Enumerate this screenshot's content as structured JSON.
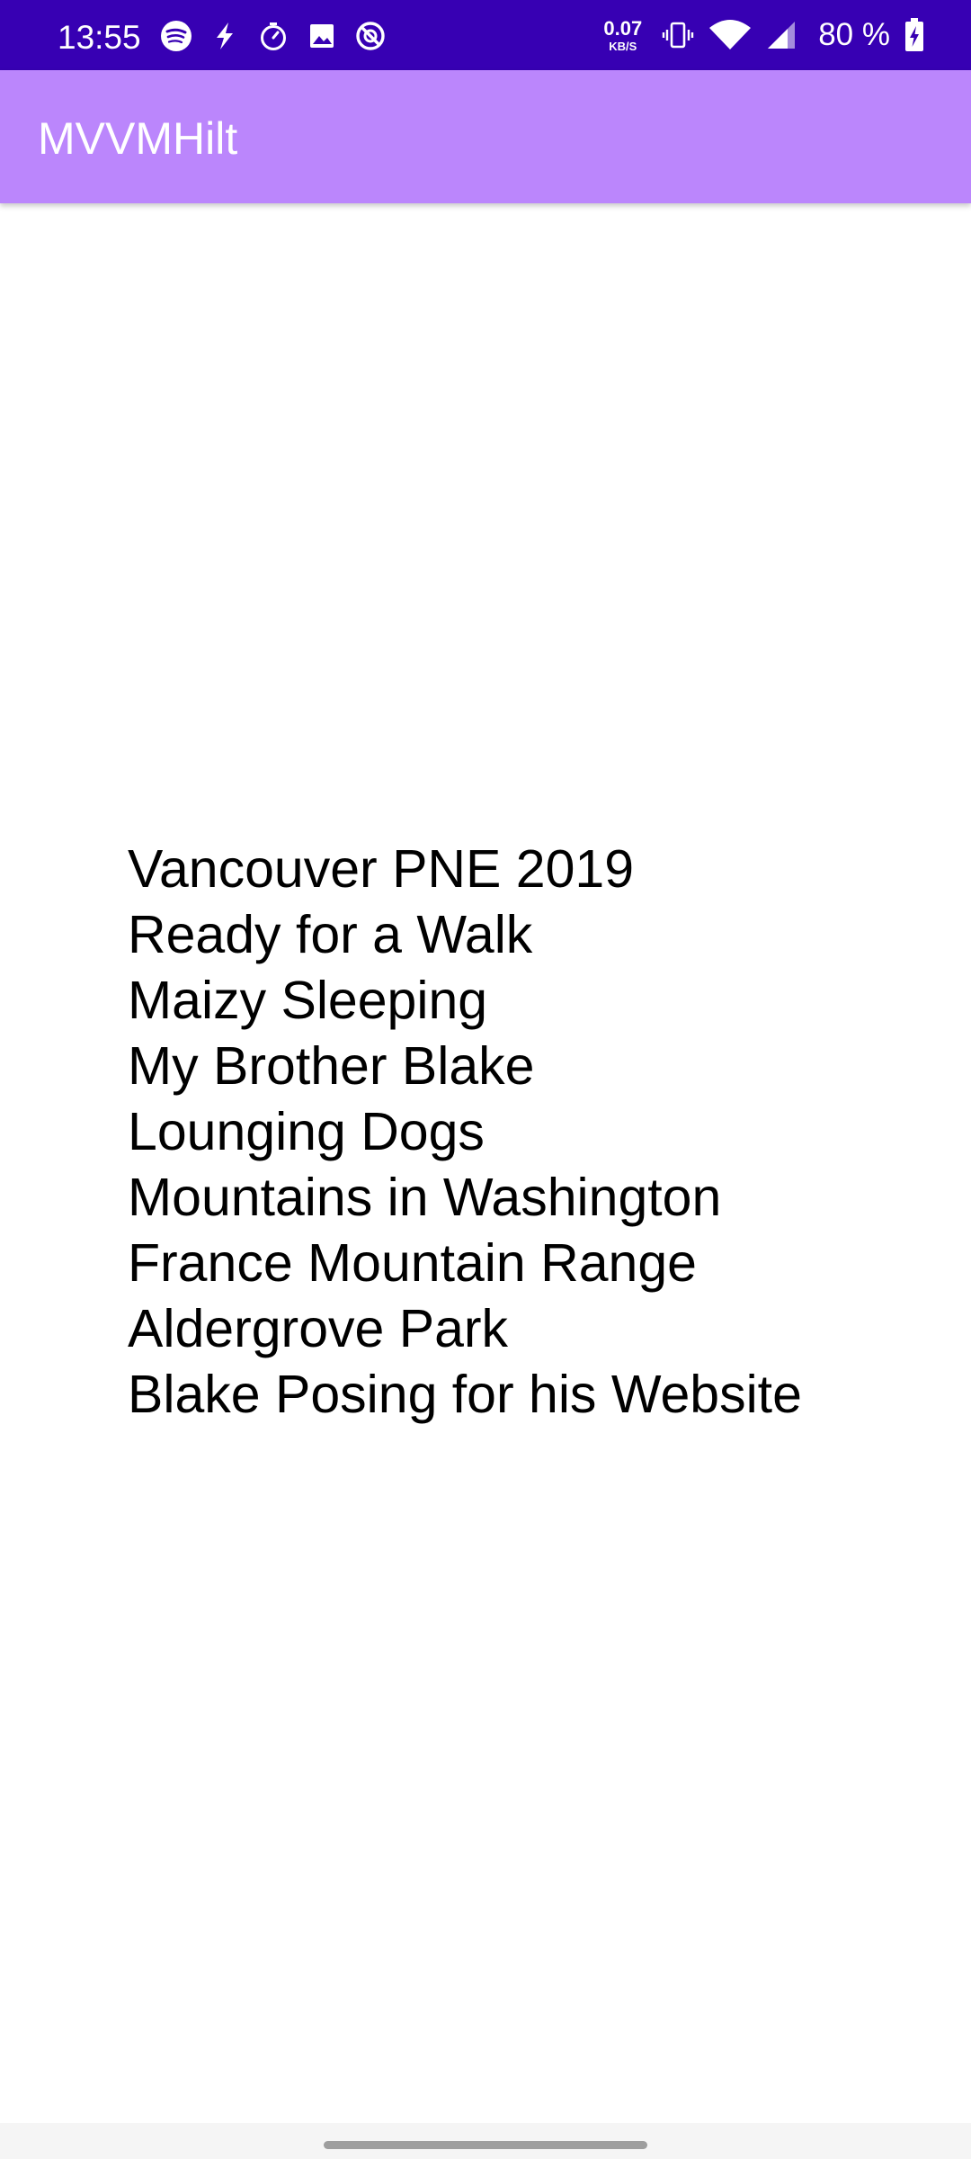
{
  "status_bar": {
    "time": "13:55",
    "net_speed_value": "0.07",
    "net_speed_unit": "KB/S",
    "battery_percent": "80 %",
    "background_color": "#3700b3",
    "left_icons": [
      "spotify-icon",
      "bolt-icon",
      "timer-icon",
      "image-icon",
      "at-sign-icon"
    ],
    "right_icons": [
      "vibrate-icon",
      "wifi-icon",
      "signal-icon",
      "battery-charging-icon"
    ]
  },
  "app_bar": {
    "title": "MVVMHilt",
    "background_color": "#bb86fc"
  },
  "photo_titles": [
    "Vancouver PNE 2019",
    "Ready for a Walk",
    "Maizy Sleeping",
    "My Brother Blake",
    "Lounging Dogs",
    "Mountains in Washington",
    "France Mountain Range",
    "Aldergrove Park",
    "Blake Posing for his Website"
  ]
}
